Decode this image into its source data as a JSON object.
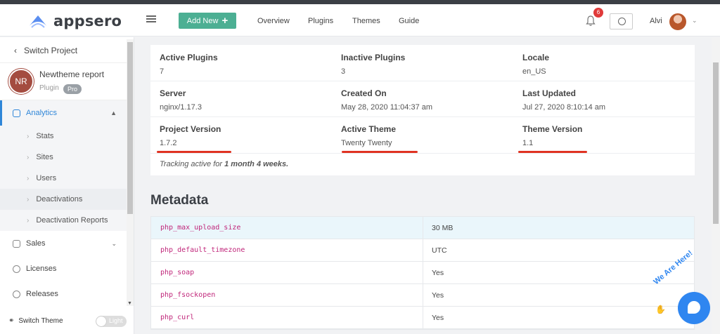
{
  "brand": {
    "name": "appsero"
  },
  "topnav": {
    "add_new": "Add New",
    "links": [
      "Overview",
      "Plugins",
      "Themes",
      "Guide"
    ],
    "notif_count": "6",
    "user_name": "Alvi"
  },
  "sidebar": {
    "switch_project": "Switch Project",
    "project": {
      "initials": "NR",
      "name": "Newtheme report",
      "type": "Plugin",
      "badge": "Pro"
    },
    "analytics": "Analytics",
    "sub_items": [
      "Stats",
      "Sites",
      "Users",
      "Deactivations",
      "Deactivation Reports"
    ],
    "sales": "Sales",
    "licenses": "Licenses",
    "releases": "Releases",
    "switch_theme": "Switch Theme",
    "theme_toggle": "Light"
  },
  "info": {
    "rows": [
      [
        {
          "label": "Active Plugins",
          "value": "7"
        },
        {
          "label": "Inactive Plugins",
          "value": "3"
        },
        {
          "label": "Locale",
          "value": "en_US"
        }
      ],
      [
        {
          "label": "Server",
          "value": "nginx/1.17.3"
        },
        {
          "label": "Created On",
          "value": "May 28, 2020 11:04:37 am"
        },
        {
          "label": "Last Updated",
          "value": "Jul 27, 2020 8:10:14 am"
        }
      ],
      [
        {
          "label": "Project Version",
          "value": "1.7.2"
        },
        {
          "label": "Active Theme",
          "value": "Twenty Twenty"
        },
        {
          "label": "Theme Version",
          "value": "1.1"
        }
      ]
    ],
    "tracking_prefix": "Tracking active for ",
    "tracking_duration": "1 month 4 weeks."
  },
  "metadata": {
    "title": "Metadata",
    "rows": [
      {
        "key": "php_max_upload_size",
        "value": "30 MB"
      },
      {
        "key": "php_default_timezone",
        "value": "UTC"
      },
      {
        "key": "php_soap",
        "value": "Yes"
      },
      {
        "key": "php_fsockopen",
        "value": "Yes"
      },
      {
        "key": "php_curl",
        "value": "Yes"
      }
    ]
  },
  "chat": {
    "tagline": "We Are Here!"
  },
  "colors": {
    "brand_green": "#4caf93",
    "accent_blue": "#2f86d8",
    "highlight_red": "#e03322",
    "meta_key": "#c0267a"
  }
}
